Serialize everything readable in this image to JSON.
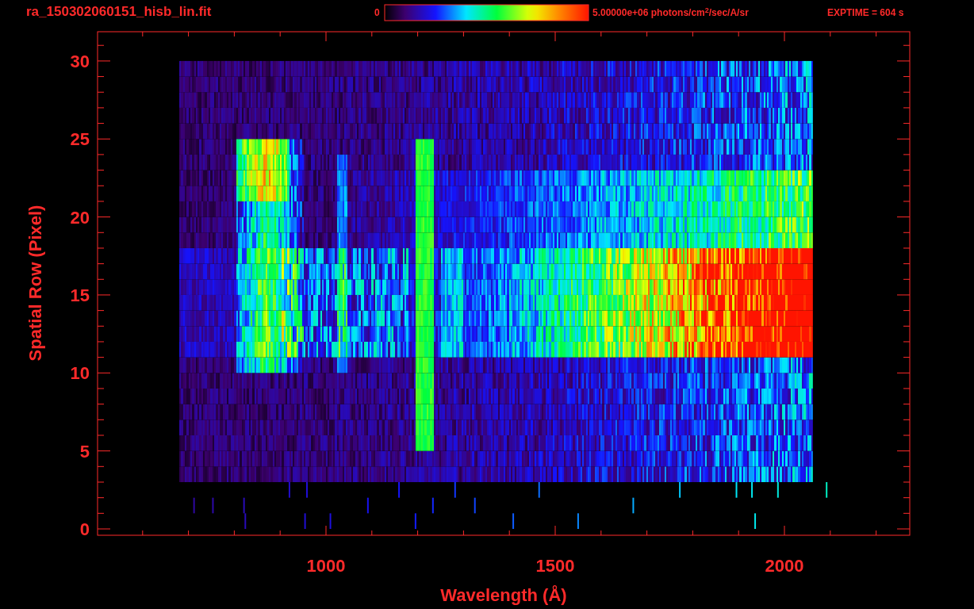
{
  "title": "ra_150302060151_hisb_lin.fit",
  "colorbar": {
    "min_label": "0",
    "max_label": "5.00000e+06 photons/cm$^{2}$/sec/A/sr"
  },
  "exposure": "EXPTIME = 604 s",
  "plot": {
    "xlabel": "Wavelength (Å)",
    "ylabel": "Spatial Row (Pixel)",
    "xticks": [
      "1000",
      "1500",
      "2000"
    ],
    "yticks": [
      "30",
      "25",
      "20",
      "15",
      "10",
      "5",
      "0"
    ]
  }
}
